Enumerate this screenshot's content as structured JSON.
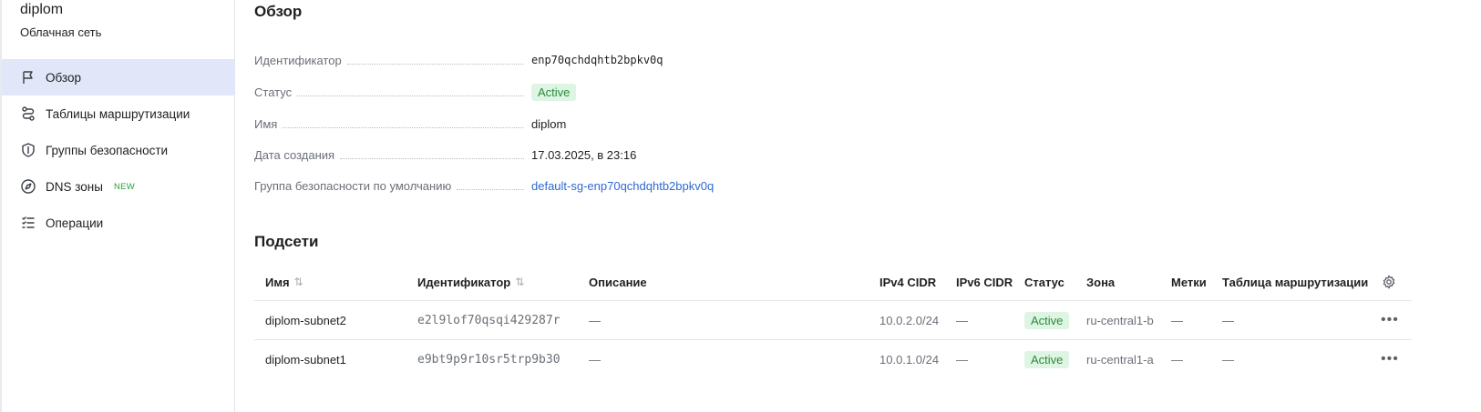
{
  "sidebar": {
    "title": "diplom",
    "subtitle": "Облачная сеть",
    "items": [
      {
        "label": "Обзор",
        "icon": "flag-icon",
        "active": true
      },
      {
        "label": "Таблицы маршрутизации",
        "icon": "route-icon"
      },
      {
        "label": "Группы безопасности",
        "icon": "shield-icon"
      },
      {
        "label": "DNS зоны",
        "icon": "compass-icon",
        "badge": "NEW"
      },
      {
        "label": "Операции",
        "icon": "list-icon"
      }
    ]
  },
  "overview": {
    "title": "Обзор",
    "props": [
      {
        "key": "Идентификатор",
        "value": "enp70qchdqhtb2bpkv0q"
      },
      {
        "key": "Статус",
        "value": "Active"
      },
      {
        "key": "Имя",
        "value": "diplom"
      },
      {
        "key": "Дата создания",
        "value": "17.03.2025, в 23:16"
      },
      {
        "key": "Группа безопасности по умолчанию",
        "value": "default-sg-enp70qchdqhtb2bpkv0q"
      }
    ]
  },
  "subnets": {
    "title": "Подсети",
    "columns": {
      "name": "Имя",
      "id": "Идентификатор",
      "description": "Описание",
      "ipv4": "IPv4 CIDR",
      "ipv6": "IPv6 CIDR",
      "status": "Статус",
      "zone": "Зона",
      "labels": "Метки",
      "route_table": "Таблица маршрутизации"
    },
    "rows": [
      {
        "name": "diplom-subnet2",
        "id": "e2l9lof70qsqi429287r",
        "description": "—",
        "ipv4": "10.0.2.0/24",
        "ipv6": "—",
        "status": "Active",
        "zone": "ru-central1-b",
        "labels": "—",
        "route_table": "—"
      },
      {
        "name": "diplom-subnet1",
        "id": "e9bt9p9r10sr5trp9b30",
        "description": "—",
        "ipv4": "10.0.1.0/24",
        "ipv6": "—",
        "status": "Active",
        "zone": "ru-central1-a",
        "labels": "—",
        "route_table": "—"
      }
    ]
  },
  "colors": {
    "accent_bg": "#e1e6f8",
    "link": "#2e6ad6",
    "status_bg": "#dff5e3",
    "status_fg": "#2a8a3a",
    "new_badge": "#2e9e3f"
  }
}
